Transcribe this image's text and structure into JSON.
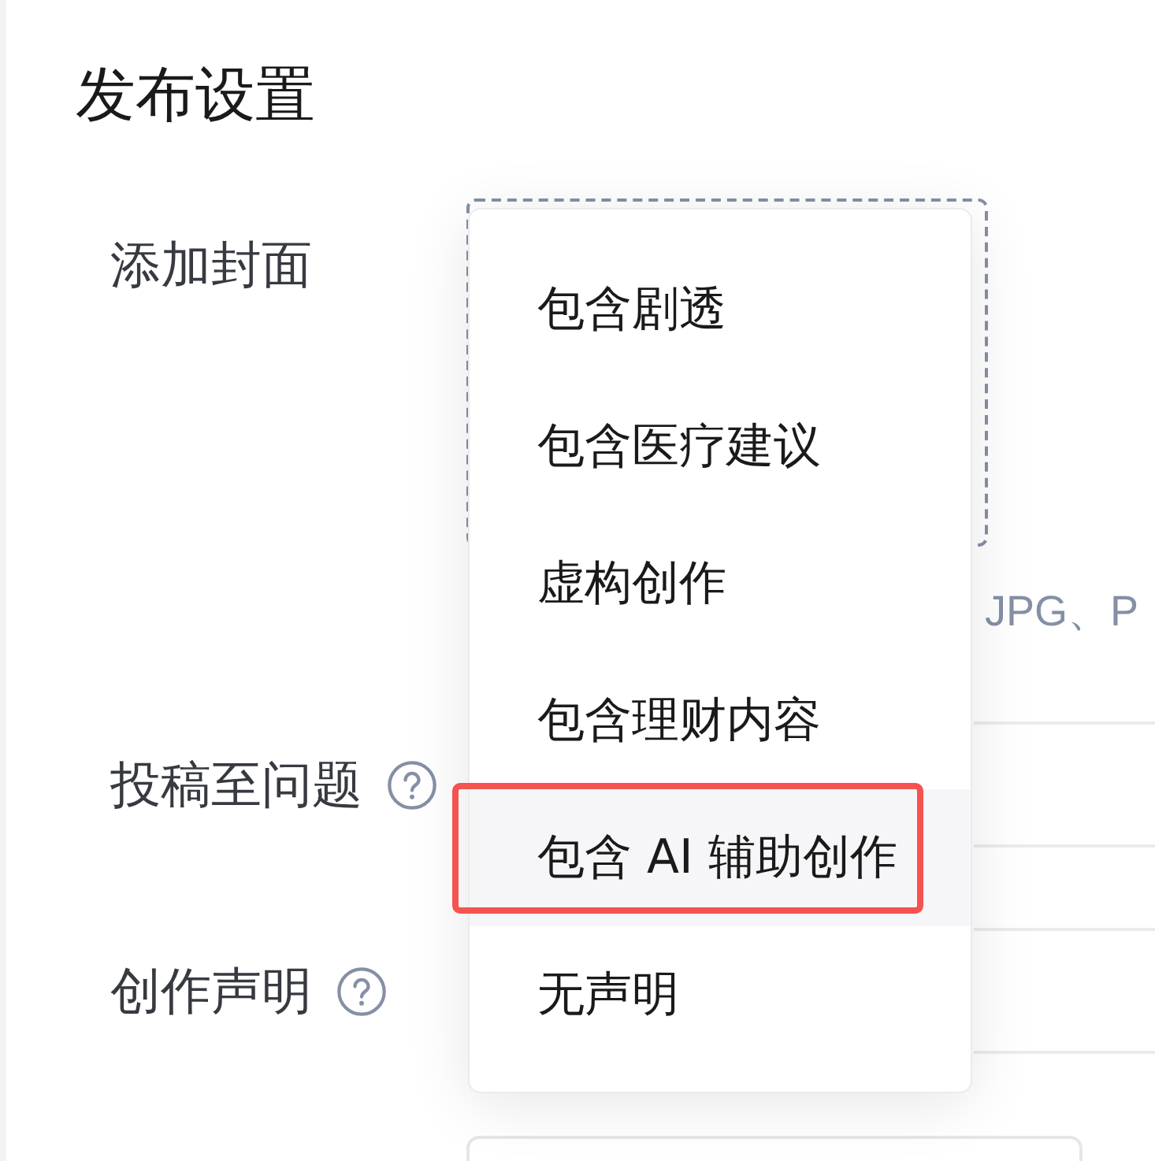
{
  "page": {
    "title": "发布设置"
  },
  "form": {
    "rows": [
      {
        "kind": "upload",
        "label": "添加封面",
        "help": false,
        "hint": "JPG、P"
      },
      {
        "kind": "field",
        "label": "投稿至问题",
        "help": true
      },
      {
        "kind": "field",
        "label": "创作声明",
        "help": true
      },
      {
        "kind": "box"
      }
    ]
  },
  "dropdown": {
    "options": [
      {
        "label": "包含剧透",
        "selected": false,
        "marked": false
      },
      {
        "label": "包含医疗建议",
        "selected": false,
        "marked": false
      },
      {
        "label": "虚构创作",
        "selected": false,
        "marked": false
      },
      {
        "label": "包含理财内容",
        "selected": false,
        "marked": false
      },
      {
        "label": "包含 AI 辅助创作",
        "selected": true,
        "marked": true
      },
      {
        "label": "无声明",
        "selected": false,
        "marked": false
      }
    ]
  }
}
